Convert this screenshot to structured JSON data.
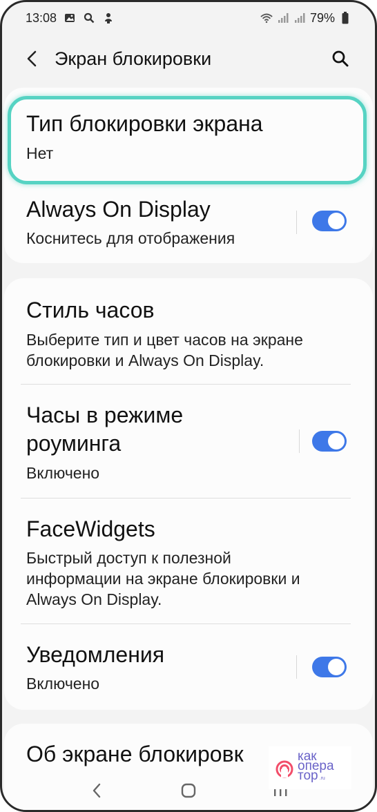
{
  "status_bar": {
    "time": "13:08",
    "battery": "79%",
    "icons_left": [
      "image-icon",
      "search-icon",
      "notification-icon"
    ],
    "icons_right": [
      "wifi-icon",
      "signal-icon",
      "signal-icon",
      "battery-icon"
    ]
  },
  "app_bar": {
    "title": "Экран блокировки",
    "back_icon": "chevron-left-icon",
    "search_icon": "search-icon"
  },
  "settings": {
    "lock_type": {
      "title": "Тип блокировки экрана",
      "subtitle": "Нет"
    },
    "aod": {
      "title": "Always On Display",
      "subtitle": "Коснитесь для отображения",
      "enabled": true
    },
    "clock_style": {
      "title": "Стиль часов",
      "subtitle_line1": "Выберите тип и цвет часов на экране",
      "subtitle_line2": "блокировки и Always On Display."
    },
    "roaming_clock": {
      "title_line1": "Часы в режиме",
      "title_line2": "роуминга",
      "subtitle": "Включено",
      "enabled": true
    },
    "facewidgets": {
      "title": "FaceWidgets",
      "subtitle_line1": "Быстрый доступ к полезной",
      "subtitle_line2": "информации на экране блокировки и",
      "subtitle_line3": "Always On Display."
    },
    "notifications": {
      "title": "Уведомления",
      "subtitle": "Включено",
      "enabled": true
    },
    "about": {
      "title": "Об экране блокировк"
    }
  },
  "nav_bar": {
    "back": "nav-back-icon",
    "home": "nav-home-icon",
    "recents": "nav-recents-icon"
  },
  "watermark": {
    "line1": "как",
    "line2": "опера",
    "line3": "тор",
    "suffix": ".ru"
  },
  "colors": {
    "accent": "#3e78e8",
    "highlight": "#56d3c3",
    "background": "#f3f3f3",
    "card": "#fcfcfc"
  }
}
